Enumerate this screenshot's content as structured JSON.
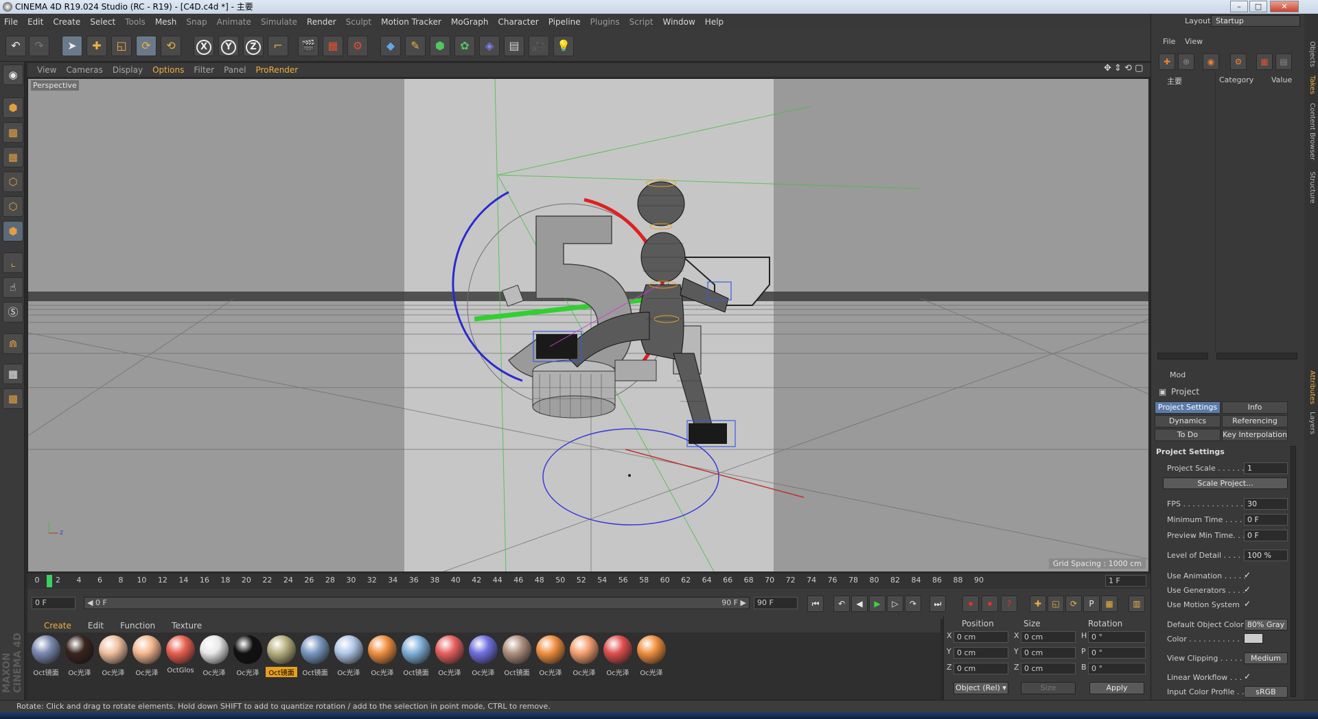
{
  "window": {
    "title": "CINEMA 4D R19.024 Studio (RC - R19) - [C4D.c4d *] - 主要",
    "min": "–",
    "max": "□",
    "close": "✕"
  },
  "menubar": [
    "File",
    "Edit",
    "Create",
    "Select",
    "Tools",
    "Mesh",
    "Snap",
    "Animate",
    "Simulate",
    "Render",
    "Sculpt",
    "Motion Tracker",
    "MoGraph",
    "Character",
    "Pipeline",
    "Plugins",
    "Script",
    "Window",
    "Help"
  ],
  "layout": {
    "label": "Layout:",
    "value": "Startup"
  },
  "toolbar": {
    "axes": [
      "X",
      "Y",
      "Z"
    ]
  },
  "viewport": {
    "menu": [
      "View",
      "Cameras",
      "Display",
      "Options",
      "Filter",
      "Panel",
      "ProRender"
    ],
    "camera_label": "Perspective",
    "grid_spacing": "Grid Spacing : 1000 cm",
    "nav": "✥ ⇕ ⟲ ▢",
    "axis_hint": "z"
  },
  "timeline": {
    "ticks": [
      0,
      2,
      4,
      6,
      8,
      10,
      12,
      14,
      16,
      18,
      20,
      22,
      24,
      26,
      28,
      30,
      32,
      34,
      36,
      38,
      40,
      42,
      44,
      46,
      48,
      50,
      52,
      54,
      56,
      58,
      60,
      62,
      64,
      66,
      68,
      70,
      72,
      74,
      76,
      78,
      80,
      82,
      84,
      86,
      88,
      90
    ],
    "current_frame": "1 F"
  },
  "transport": {
    "start": "0 F",
    "range_start": "◀ 0 F",
    "range_end": "90 F ▶",
    "end": "90 F"
  },
  "materials": {
    "menu": [
      "Create",
      "Edit",
      "Function",
      "Texture"
    ],
    "items": [
      {
        "label": "Oct镜面",
        "color": "#7c8ab0"
      },
      {
        "label": "Oc光泽",
        "color": "#3a2420"
      },
      {
        "label": "Oc光泽",
        "color": "#f0c0a0"
      },
      {
        "label": "Oc光泽",
        "color": "#f5b890"
      },
      {
        "label": "OctGlos",
        "color": "#e86050"
      },
      {
        "label": "Oc光泽",
        "color": "#e8e8e8"
      },
      {
        "label": "Oc光泽",
        "color": "#111111"
      },
      {
        "label": "Oct镜面",
        "color": "#b8b080"
      },
      {
        "label": "Oct镜面",
        "color": "#7a98c0"
      },
      {
        "label": "Oc光泽",
        "color": "#b0c8e8"
      },
      {
        "label": "Oc光泽",
        "color": "#f09040"
      },
      {
        "label": "Oct镜面",
        "color": "#80b0d8"
      },
      {
        "label": "Oc光泽",
        "color": "#e86060"
      },
      {
        "label": "Oc光泽",
        "color": "#7070e0"
      },
      {
        "label": "Oct镜面",
        "color": "#b09080"
      },
      {
        "label": "Oc光泽",
        "color": "#f09040"
      },
      {
        "label": "Oc光泽",
        "color": "#f5a070"
      },
      {
        "label": "Oc光泽",
        "color": "#e05050"
      },
      {
        "label": "Oc光泽",
        "color": "#f09040"
      }
    ],
    "selected_index": 7
  },
  "coords": {
    "headers": [
      "Position",
      "Size",
      "Rotation"
    ],
    "rows": [
      {
        "axis": "X",
        "pos": "0 cm",
        "size_axis": "X",
        "size": "0 cm",
        "rot_axis": "H",
        "rot": "0 °"
      },
      {
        "axis": "Y",
        "pos": "0 cm",
        "size_axis": "Y",
        "size": "0 cm",
        "rot_axis": "P",
        "rot": "0 °"
      },
      {
        "axis": "Z",
        "pos": "0 cm",
        "size_axis": "Z",
        "size": "0 cm",
        "rot_axis": "B",
        "rot": "0 °"
      }
    ],
    "mode": "Object (Rel) ▾",
    "size_mode": "Size",
    "apply": "Apply"
  },
  "objects_panel": {
    "menu": [
      "File",
      "View"
    ],
    "columns": {
      "name": "主要",
      "category": "Category",
      "value": "Value"
    }
  },
  "attributes": {
    "menu": "Mod",
    "object": "Project",
    "tabs": [
      "Project Settings",
      "Info",
      "Dynamics",
      "Referencing",
      "To Do",
      "Key Interpolation"
    ],
    "section": "Project Settings",
    "fields": {
      "project_scale": {
        "label": "Project Scale . . . . . .",
        "value": "1"
      },
      "scale_project": "Scale Project...",
      "fps": {
        "label": "FPS . . . . . . . . . . . . .",
        "value": "30"
      },
      "min_time": {
        "label": "Minimum Time . . . . .",
        "value": "0 F"
      },
      "preview_min": {
        "label": "Preview Min Time. . .",
        "value": "0 F"
      },
      "lod": {
        "label": "Level of Detail . . . . .",
        "value": "100 %"
      },
      "use_animation": {
        "label": "Use Animation . . . . .",
        "value": "✓"
      },
      "use_generators": {
        "label": "Use Generators . . . .",
        "value": "✓"
      },
      "use_motion": {
        "label": "Use Motion System",
        "value": "✓"
      },
      "default_color": {
        "label": "Default Object Color",
        "value": "80% Gray"
      },
      "color": {
        "label": "Color . . . . . . . . . . .",
        "value": ""
      },
      "view_clipping": {
        "label": "View Clipping . . . . .",
        "value": "Medium"
      },
      "linear_workflow": {
        "label": "Linear Workflow . . .",
        "value": "✓"
      },
      "input_color": {
        "label": "Input Color Profile . .",
        "value": "sRGB"
      }
    }
  },
  "right_tabs": [
    "Objects",
    "Takes",
    "Content Browser",
    "Structure"
  ],
  "right_tabs_lower": [
    "Attributes",
    "Layers"
  ],
  "status": "Rotate: Click and drag to rotate elements. Hold down SHIFT to add to quantize rotation / add to the selection in point mode, CTRL to remove.",
  "logo": "MAXON CINEMA 4D"
}
